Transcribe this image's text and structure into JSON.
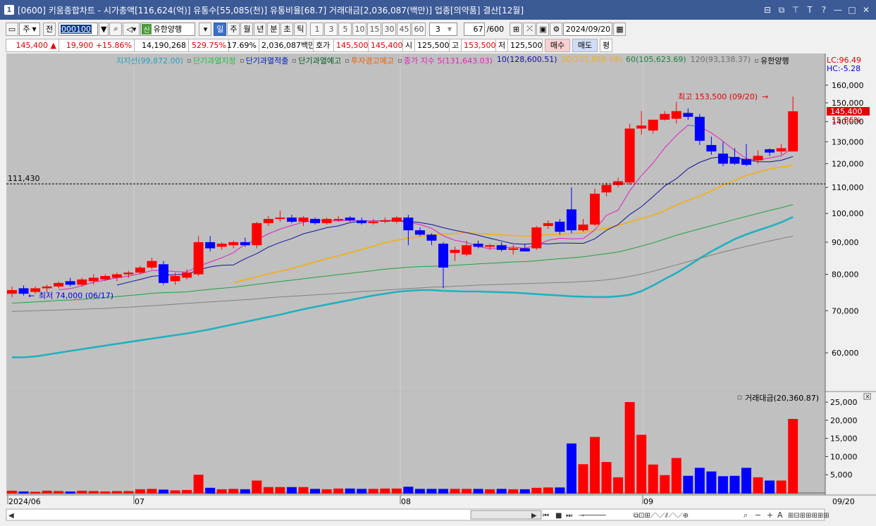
{
  "title": {
    "badge": "1",
    "text": "[0600] 키움종합차트 - 시가총액[116,624(억)] 유통수[55,085(천)] 유통비율[68.7] 거래대금[2,036,087(백만)] 업종[의약품] 결산[12월]"
  },
  "toolbar1": {
    "period_sel": "주",
    "prev_label": "전",
    "code": "000100",
    "stock_badge": "신",
    "stock_name": "유한양행",
    "tabs": [
      "일",
      "주",
      "월",
      "년",
      "분",
      "초",
      "틱"
    ],
    "active_tab": "일",
    "nums": [
      "1",
      "3",
      "5",
      "10",
      "15",
      "30",
      "45",
      "60"
    ],
    "num_sel": "3",
    "count": "67",
    "count_total": "/600",
    "date": "2024/09/20"
  },
  "toolbar2": {
    "price": "145,400",
    "change": "▲ 19,900",
    "change_pct": "+15.86%",
    "volume": "14,190,268",
    "vol_ratio": "529.75%",
    "turnover": "17.69%",
    "amount": "2,036,087백만",
    "quote_label": "호가",
    "ask": "145,500",
    "bid": "145,400",
    "open_label": "시",
    "open": "125,500",
    "high_label": "고",
    "high": "153,500",
    "low_label": "저",
    "low": "125,500",
    "buy": "매수",
    "sell": "매도",
    "avg": "평"
  },
  "legend": {
    "support": "지지선(99,872.00)",
    "short_overheat": "단기과열지정",
    "short_release": "단기과열적출",
    "short_warn": "단기과열예고",
    "invest_warn": "투자경고예고",
    "close_ma5": "종가 지수 5(131,643.03)",
    "ma10": "10(128,600.51)",
    "ma20": "20(122,858.98)",
    "ma60": "60(105,623.69)",
    "ma120": "120(93,138.37)",
    "name": "유한양행"
  },
  "side": {
    "lc": "LC:96.49",
    "hc": "HC:-5.28",
    "cur_price": "145,400",
    "cur_pct": "15.86%"
  },
  "annotations": {
    "support_line": "111,430",
    "high_label": "최고 153,500 (09/20)",
    "low_label": "최저 74,000 (06/17)"
  },
  "volume_legend": "거래대금(20,360.87)",
  "colors": {
    "up": "#ff0000",
    "down": "#0000ff",
    "bg": "#c0c0c0",
    "ma5": "#e020c0",
    "ma10": "#1010a0",
    "ma20": "#f0b020",
    "ma60": "#20a040",
    "ma120": "#808080",
    "support": "#20b0c0"
  },
  "chart_data": {
    "type": "candlestick",
    "price_ticks": [
      "160,000",
      "150,000",
      "140,000",
      "130,000",
      "120,000",
      "110,000",
      "100,000",
      "90,000",
      "80,000",
      "70,000",
      "60,000"
    ],
    "volume_ticks": [
      "25,000",
      "20,000",
      "15,000",
      "10,000",
      "5,000"
    ],
    "x_labels": [
      "2024/06",
      "07",
      "08",
      "09",
      "09/20"
    ],
    "candles": [
      {
        "o": 74500,
        "h": 76500,
        "l": 73500,
        "c": 75500
      },
      {
        "o": 76000,
        "h": 76800,
        "l": 74000,
        "c": 74500
      },
      {
        "o": 75000,
        "h": 76500,
        "l": 74500,
        "c": 76000
      },
      {
        "o": 76000,
        "h": 77000,
        "l": 75000,
        "c": 76500
      },
      {
        "o": 76500,
        "h": 78000,
        "l": 76000,
        "c": 77500
      },
      {
        "o": 78000,
        "h": 79000,
        "l": 76500,
        "c": 77000
      },
      {
        "o": 77000,
        "h": 79000,
        "l": 76500,
        "c": 78500
      },
      {
        "o": 78000,
        "h": 80000,
        "l": 77000,
        "c": 79000
      },
      {
        "o": 78500,
        "h": 80000,
        "l": 78000,
        "c": 79500
      },
      {
        "o": 79000,
        "h": 80500,
        "l": 78000,
        "c": 80000
      },
      {
        "o": 80000,
        "h": 81000,
        "l": 79000,
        "c": 80500
      },
      {
        "o": 80500,
        "h": 82500,
        "l": 80000,
        "c": 82000
      },
      {
        "o": 82000,
        "h": 85000,
        "l": 81500,
        "c": 84000
      },
      {
        "o": 83000,
        "h": 84000,
        "l": 77000,
        "c": 77500
      },
      {
        "o": 78000,
        "h": 80500,
        "l": 77000,
        "c": 79500
      },
      {
        "o": 79000,
        "h": 81500,
        "l": 78500,
        "c": 80500
      },
      {
        "o": 80000,
        "h": 92000,
        "l": 79500,
        "c": 90000
      },
      {
        "o": 90000,
        "h": 92000,
        "l": 87000,
        "c": 88000
      },
      {
        "o": 88500,
        "h": 90000,
        "l": 87500,
        "c": 89500
      },
      {
        "o": 89000,
        "h": 90500,
        "l": 88000,
        "c": 90000
      },
      {
        "o": 90000,
        "h": 91500,
        "l": 88500,
        "c": 89000
      },
      {
        "o": 89000,
        "h": 97000,
        "l": 88000,
        "c": 96500
      },
      {
        "o": 96500,
        "h": 99000,
        "l": 95500,
        "c": 98000
      },
      {
        "o": 98000,
        "h": 101000,
        "l": 97000,
        "c": 98500
      },
      {
        "o": 98500,
        "h": 99500,
        "l": 96500,
        "c": 97000
      },
      {
        "o": 97000,
        "h": 99000,
        "l": 95500,
        "c": 98500
      },
      {
        "o": 98000,
        "h": 98500,
        "l": 96000,
        "c": 96500
      },
      {
        "o": 96500,
        "h": 98500,
        "l": 96000,
        "c": 98000
      },
      {
        "o": 97500,
        "h": 99000,
        "l": 97000,
        "c": 98000
      },
      {
        "o": 98500,
        "h": 99000,
        "l": 97000,
        "c": 97500
      },
      {
        "o": 97500,
        "h": 98500,
        "l": 96000,
        "c": 96500
      },
      {
        "o": 96500,
        "h": 98000,
        "l": 96000,
        "c": 97000
      },
      {
        "o": 97000,
        "h": 98500,
        "l": 96500,
        "c": 97500
      },
      {
        "o": 97000,
        "h": 99000,
        "l": 96500,
        "c": 98500
      },
      {
        "o": 98500,
        "h": 99500,
        "l": 89000,
        "c": 94000
      },
      {
        "o": 94000,
        "h": 95000,
        "l": 92000,
        "c": 92500
      },
      {
        "o": 92500,
        "h": 93000,
        "l": 89000,
        "c": 90500
      },
      {
        "o": 89500,
        "h": 90000,
        "l": 76000,
        "c": 82000
      },
      {
        "o": 86500,
        "h": 88500,
        "l": 84000,
        "c": 87500
      },
      {
        "o": 86000,
        "h": 90500,
        "l": 85500,
        "c": 89000
      },
      {
        "o": 89500,
        "h": 90500,
        "l": 88000,
        "c": 88500
      },
      {
        "o": 88500,
        "h": 89500,
        "l": 87500,
        "c": 89000
      },
      {
        "o": 89000,
        "h": 90000,
        "l": 87000,
        "c": 87500
      },
      {
        "o": 87500,
        "h": 89000,
        "l": 86000,
        "c": 88000
      },
      {
        "o": 88000,
        "h": 89500,
        "l": 87000,
        "c": 87000
      },
      {
        "o": 88000,
        "h": 95500,
        "l": 87500,
        "c": 95000
      },
      {
        "o": 95500,
        "h": 97500,
        "l": 94500,
        "c": 96500
      },
      {
        "o": 97000,
        "h": 98000,
        "l": 92500,
        "c": 93500
      },
      {
        "o": 101500,
        "h": 110000,
        "l": 93000,
        "c": 94000
      },
      {
        "o": 94000,
        "h": 98000,
        "l": 93500,
        "c": 96000
      },
      {
        "o": 96000,
        "h": 109500,
        "l": 95500,
        "c": 107500
      },
      {
        "o": 108000,
        "h": 112000,
        "l": 106500,
        "c": 111000
      },
      {
        "o": 111000,
        "h": 114000,
        "l": 110000,
        "c": 112500
      },
      {
        "o": 112000,
        "h": 139000,
        "l": 111000,
        "c": 136500
      },
      {
        "o": 136500,
        "h": 145500,
        "l": 133500,
        "c": 138000
      },
      {
        "o": 135500,
        "h": 141000,
        "l": 134000,
        "c": 141000
      },
      {
        "o": 141000,
        "h": 145500,
        "l": 140500,
        "c": 144000
      },
      {
        "o": 141500,
        "h": 150500,
        "l": 139000,
        "c": 145500
      },
      {
        "o": 144500,
        "h": 147000,
        "l": 141000,
        "c": 142500
      },
      {
        "o": 142500,
        "h": 144000,
        "l": 128500,
        "c": 130500
      },
      {
        "o": 128500,
        "h": 132500,
        "l": 124000,
        "c": 125500
      },
      {
        "o": 124500,
        "h": 130000,
        "l": 119000,
        "c": 120000
      },
      {
        "o": 123000,
        "h": 127000,
        "l": 119500,
        "c": 120000
      },
      {
        "o": 122000,
        "h": 129000,
        "l": 119000,
        "c": 119500
      },
      {
        "o": 121500,
        "h": 126000,
        "l": 120000,
        "c": 123500
      },
      {
        "o": 126500,
        "h": 127000,
        "l": 123500,
        "c": 125000
      },
      {
        "o": 125500,
        "h": 129000,
        "l": 124000,
        "c": 127000
      },
      {
        "o": 125500,
        "h": 153500,
        "l": 125500,
        "c": 145400
      }
    ],
    "volume": [
      600,
      400,
      300,
      600,
      500,
      400,
      600,
      500,
      400,
      500,
      500,
      1000,
      1100,
      900,
      700,
      800,
      5000,
      1400,
      1000,
      1100,
      1000,
      3400,
      1600,
      1600,
      1600,
      1600,
      1100,
      1000,
      1200,
      1200,
      1100,
      1100,
      1200,
      1200,
      1700,
      1100,
      1100,
      1100,
      1100,
      1100,
      1100,
      1000,
      1100,
      1000,
      1000,
      1400,
      1500,
      1500,
      13600,
      7900,
      15400,
      8500,
      4300,
      25000,
      16000,
      7800,
      4900,
      9600,
      4700,
      6900,
      5900,
      4600,
      4700,
      6900,
      4300,
      3400,
      3400,
      20360
    ],
    "ma": {
      "ma5": [
        null,
        null,
        null,
        null,
        75600,
        75900,
        76700,
        77700,
        78300,
        79000,
        79500,
        80200,
        81100,
        81100,
        80800,
        80700,
        82400,
        83700,
        85000,
        86600,
        89300,
        90800,
        92800,
        94400,
        95700,
        96800,
        97500,
        97300,
        97300,
        97500,
        97300,
        97300,
        97300,
        97300,
        96800,
        96000,
        94700,
        92100,
        90600,
        89900,
        88500,
        87900,
        88100,
        88400,
        88000,
        89100,
        90600,
        91300,
        91100,
        91200,
        94100,
        99300,
        101200,
        108700,
        114900,
        120300,
        127200,
        133100,
        138200,
        137500,
        134300,
        130300,
        126000,
        122200,
        121600,
        122600,
        123500,
        127200
      ],
      "ma10": [
        null,
        null,
        null,
        null,
        null,
        null,
        null,
        null,
        null,
        76900,
        77700,
        78500,
        79400,
        79700,
        79900,
        80000,
        81300,
        82200,
        82700,
        82800,
        84700,
        86300,
        88400,
        89900,
        91200,
        92800,
        93800,
        94900,
        95500,
        96700,
        97200,
        97300,
        97400,
        97400,
        97200,
        96700,
        96000,
        94900,
        94000,
        93200,
        92300,
        91300,
        90400,
        89500,
        89300,
        89600,
        89400,
        89700,
        89700,
        89600,
        91100,
        94000,
        96000,
        99600,
        102500,
        106400,
        110600,
        113600,
        117800,
        120600,
        122500,
        123200,
        122600,
        121800,
        120900,
        120800,
        121500,
        123200
      ],
      "ma20": [
        null,
        null,
        null,
        null,
        null,
        null,
        null,
        null,
        null,
        null,
        null,
        null,
        null,
        null,
        null,
        null,
        null,
        null,
        null,
        77600,
        78400,
        79200,
        80100,
        80900,
        81700,
        82700,
        83700,
        84700,
        85600,
        86600,
        87600,
        88700,
        89800,
        90600,
        91300,
        91900,
        92400,
        92700,
        92900,
        93200,
        92900,
        92600,
        92400,
        92200,
        92000,
        92300,
        92500,
        92600,
        92900,
        93200,
        94100,
        94700,
        95700,
        96900,
        98100,
        99400,
        101000,
        103100,
        104900,
        106600,
        108600,
        111000,
        112900,
        114900,
        116300,
        117700,
        118500,
        119300
      ],
      "ma60": [
        72000,
        72100,
        72300,
        72500,
        72700,
        72800,
        73000,
        73200,
        73500,
        73700,
        74000,
        74300,
        74600,
        74800,
        74900,
        75000,
        75400,
        75700,
        76000,
        76300,
        76700,
        77100,
        77500,
        77900,
        78300,
        78700,
        79100,
        79500,
        79900,
        80300,
        80700,
        81100,
        81500,
        81800,
        82100,
        82300,
        82400,
        82500,
        82700,
        82900,
        83100,
        83300,
        83500,
        83700,
        83800,
        84100,
        84400,
        84700,
        85000,
        85300,
        85800,
        86300,
        86800,
        87700,
        88700,
        89800,
        91000,
        92300,
        93400,
        94500,
        95600,
        96700,
        97800,
        98900,
        100000,
        101100,
        102100,
        103300
      ],
      "ma120": [
        69800,
        69900,
        70000,
        70100,
        70200,
        70300,
        70400,
        70500,
        70600,
        70800,
        70900,
        71100,
        71300,
        71500,
        71700,
        71900,
        72100,
        72300,
        72500,
        72700,
        72900,
        73100,
        73400,
        73600,
        73800,
        74000,
        74200,
        74400,
        74600,
        74800,
        75100,
        75300,
        75500,
        75700,
        75900,
        76100,
        76300,
        76400,
        76600,
        76700,
        76900,
        77000,
        77100,
        77200,
        77300,
        77400,
        77500,
        77600,
        77700,
        77900,
        78100,
        78400,
        78800,
        79400,
        80100,
        80900,
        81800,
        82800,
        83800,
        84800,
        85800,
        86800,
        87700,
        88600,
        89500,
        90400,
        91200,
        92000
      ],
      "support": [
        59000,
        59000,
        59200,
        59600,
        60000,
        60400,
        60800,
        61200,
        61600,
        62000,
        62400,
        62800,
        63200,
        63600,
        64000,
        64400,
        64900,
        65400,
        66000,
        66600,
        67200,
        67800,
        68400,
        69000,
        69700,
        70400,
        71000,
        71600,
        72200,
        72800,
        73400,
        74000,
        74500,
        75000,
        75300,
        75500,
        75500,
        75300,
        75200,
        75100,
        75100,
        75000,
        74900,
        74800,
        74600,
        74400,
        74200,
        74000,
        73800,
        73700,
        73600,
        73600,
        73800,
        74200,
        75200,
        76800,
        78600,
        80400,
        82500,
        84800,
        87000,
        89000,
        91000,
        92600,
        94000,
        95300,
        96800,
        98700
      ]
    }
  }
}
